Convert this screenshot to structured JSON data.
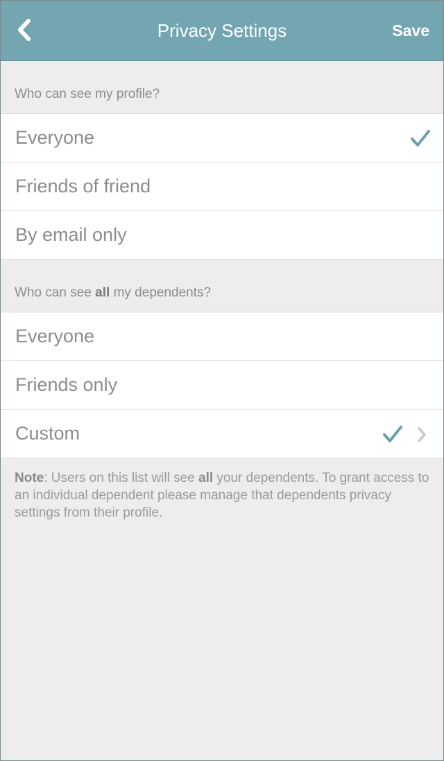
{
  "header": {
    "title": "Privacy Settings",
    "save_label": "Save",
    "back_icon": "chevron-left-icon"
  },
  "profile_section": {
    "title": "Who can see my profile?",
    "options": [
      {
        "label": "Everyone",
        "selected": true
      },
      {
        "label": "Friends of friend",
        "selected": false
      },
      {
        "label": "By email only",
        "selected": false
      }
    ]
  },
  "dependents_section": {
    "title_pre": "Who can see ",
    "title_bold": "all",
    "title_post": " my dependents?",
    "options": [
      {
        "label": "Everyone",
        "selected": false
      },
      {
        "label": "Friends only",
        "selected": false
      },
      {
        "label": "Custom",
        "selected": true,
        "has_disclosure": true
      }
    ]
  },
  "note": {
    "label": "Note",
    "text_pre": ": Users on this list will see ",
    "text_bold": "all",
    "text_post": " your dependents. To grant access to an individual dependent please manage that dependents privacy settings from their profile."
  },
  "colors": {
    "accent": "#74a6b1",
    "checkmark": "#6b9fac",
    "background": "#ededed",
    "text_secondary": "#8c8c8c"
  }
}
